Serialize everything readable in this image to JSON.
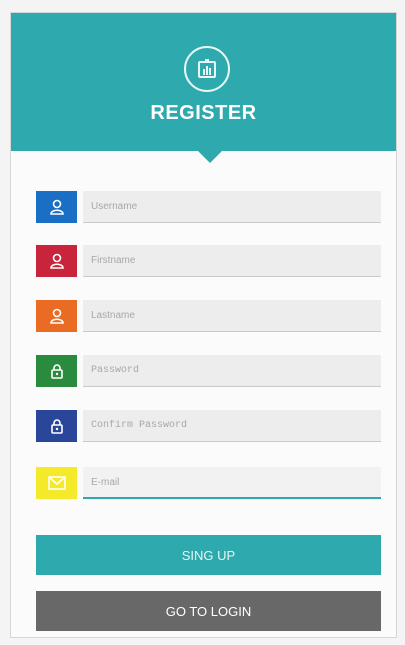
{
  "header": {
    "title": "REGISTER",
    "background": "#2ea9ad",
    "logo_icon": "chart-badge-icon"
  },
  "fields": [
    {
      "name": "username",
      "placeholder": "Username",
      "icon": "user-icon",
      "color": "#1a6fc4"
    },
    {
      "name": "firstname",
      "placeholder": "Firstname",
      "icon": "user-icon",
      "color": "#c8243c"
    },
    {
      "name": "lastname",
      "placeholder": "Lastname",
      "icon": "user-icon",
      "color": "#ea6c24"
    },
    {
      "name": "password",
      "placeholder": "Password",
      "icon": "lock-icon",
      "color": "#2a8a3e"
    },
    {
      "name": "confirm_password",
      "placeholder": "Confirm Password",
      "icon": "lock-icon",
      "color": "#2a469a"
    },
    {
      "name": "email",
      "placeholder": "E-mail",
      "icon": "mail-icon",
      "color": "#f5ea2a"
    }
  ],
  "buttons": {
    "signup_label": "SING UP",
    "signup_color": "#2ea9ad",
    "login_label": "GO TO LOGIN",
    "login_color": "#686868"
  }
}
